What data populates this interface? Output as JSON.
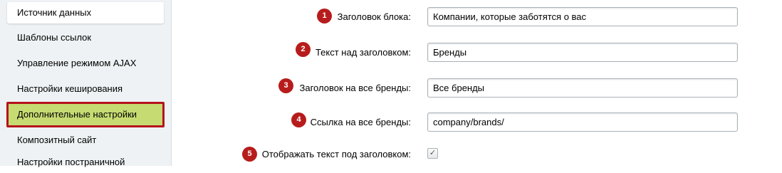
{
  "sidebar": {
    "items": [
      {
        "label": "Источник данных"
      },
      {
        "label": "Шаблоны ссылок"
      },
      {
        "label": "Управление режимом AJAX"
      },
      {
        "label": "Настройки кеширования"
      },
      {
        "label": "Дополнительные настройки"
      },
      {
        "label": "Композитный сайт"
      },
      {
        "label": "Настройки постраничной"
      }
    ]
  },
  "form": {
    "rows": [
      {
        "number": "1",
        "label": "Заголовок блока:",
        "value": "Компании, которые заботятся о вас"
      },
      {
        "number": "2",
        "label": "Текст над заголовком:",
        "value": "Бренды"
      },
      {
        "number": "3",
        "label": "Заголовок на все бренды:",
        "value": "Все бренды"
      },
      {
        "number": "4",
        "label": "Ссылка на все бренды:",
        "value": "company/brands/"
      },
      {
        "number": "5",
        "label": "Отображать текст под заголовком:",
        "checked": true
      }
    ]
  },
  "checkbox_glyph": "✓",
  "colors": {
    "badge": "#b71c1c",
    "active_item_bg": "#c6db72",
    "active_item_border": "#b5121b",
    "sidebar_bg": "#eef2f4"
  }
}
